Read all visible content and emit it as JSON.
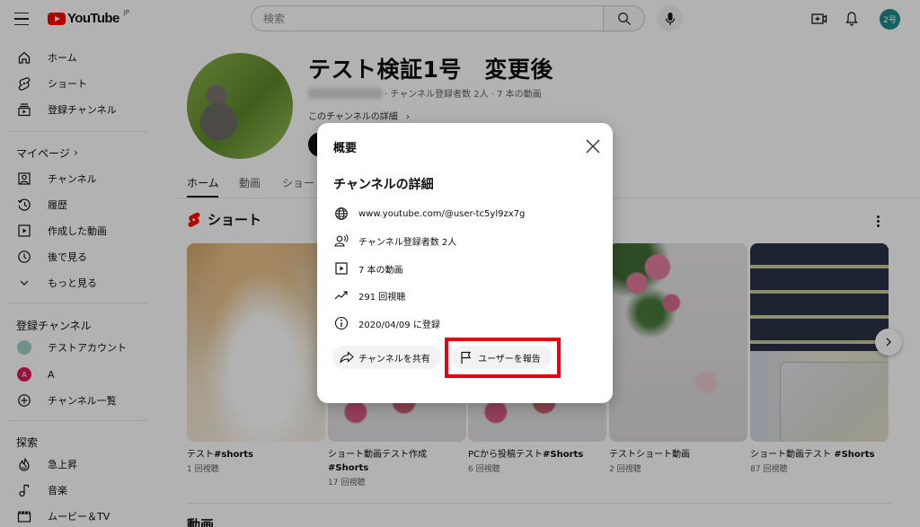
{
  "header": {
    "logo_text": "YouTube",
    "logo_region": "JP",
    "search_placeholder": "検索",
    "avatar_text": "2号",
    "icons": [
      "menu-icon",
      "search-icon",
      "mic-icon",
      "create-video-icon",
      "bell-icon"
    ]
  },
  "sidebar": {
    "main": [
      {
        "label": "ホーム",
        "icon": "home-icon"
      },
      {
        "label": "ショート",
        "icon": "shorts-icon"
      },
      {
        "label": "登録チャンネル",
        "icon": "subscriptions-icon"
      }
    ],
    "mypage_heading": "マイページ",
    "mypage": [
      {
        "label": "チャンネル",
        "icon": "channel-icon"
      },
      {
        "label": "履歴",
        "icon": "history-icon"
      },
      {
        "label": "作成した動画",
        "icon": "your-videos-icon"
      },
      {
        "label": "後で見る",
        "icon": "watch-later-icon"
      },
      {
        "label": "もっと見る",
        "icon": "chevron-down-icon"
      }
    ],
    "subs_heading": "登録チャンネル",
    "subs": [
      {
        "label": "テストアカウント",
        "avatar_color": "#7fbfb0",
        "avatar_text": ""
      },
      {
        "label": "A",
        "avatar_color": "#c2185b",
        "avatar_text": "A"
      },
      {
        "label": "チャンネル一覧",
        "icon": "add-circle-icon"
      }
    ],
    "explore_heading": "探索",
    "explore": [
      {
        "label": "急上昇",
        "icon": "trending-icon"
      },
      {
        "label": "音楽",
        "icon": "music-icon"
      },
      {
        "label": "ムービー＆TV",
        "icon": "movies-icon"
      }
    ]
  },
  "channel": {
    "name": "テスト検証1号　変更後",
    "meta": "· チャンネル登録者数 2人 · 7 本の動画",
    "more_link": "このチャンネルの詳細",
    "tabs": [
      {
        "label": "ホーム",
        "active": true
      },
      {
        "label": "動画",
        "active": false
      },
      {
        "label": "ショート",
        "active": false
      }
    ],
    "shorts_section_title": "ショート",
    "shorts": [
      {
        "title": "テスト#shorts",
        "views": "1 回視聴"
      },
      {
        "title": "ショート動画テスト作成 #Shorts",
        "views": "17 回視聴"
      },
      {
        "title": "PCから投稿テスト#Shorts",
        "views": "6 回視聴"
      },
      {
        "title": "テストショート動画",
        "views": "2 回視聴"
      },
      {
        "title": "ショート動画テスト #Shorts",
        "views": "87 回視聴"
      }
    ],
    "videos_section_title": "動画"
  },
  "dialog": {
    "title": "概要",
    "section_title": "チャンネルの詳細",
    "rows": [
      {
        "icon": "globe-icon",
        "text": "www.youtube.com/@user-tc5yl9zx7g"
      },
      {
        "icon": "subscribers-icon",
        "text": "チャンネル登録者数 2人"
      },
      {
        "icon": "video-icon",
        "text": "7 本の動画"
      },
      {
        "icon": "trending-up-icon",
        "text": "291 回視聴"
      },
      {
        "icon": "info-icon",
        "text": "2020/04/09 に登録"
      }
    ],
    "share_button": "チャンネルを共有",
    "report_button": "ユーザーを報告",
    "highlight_color": "#e60012"
  }
}
